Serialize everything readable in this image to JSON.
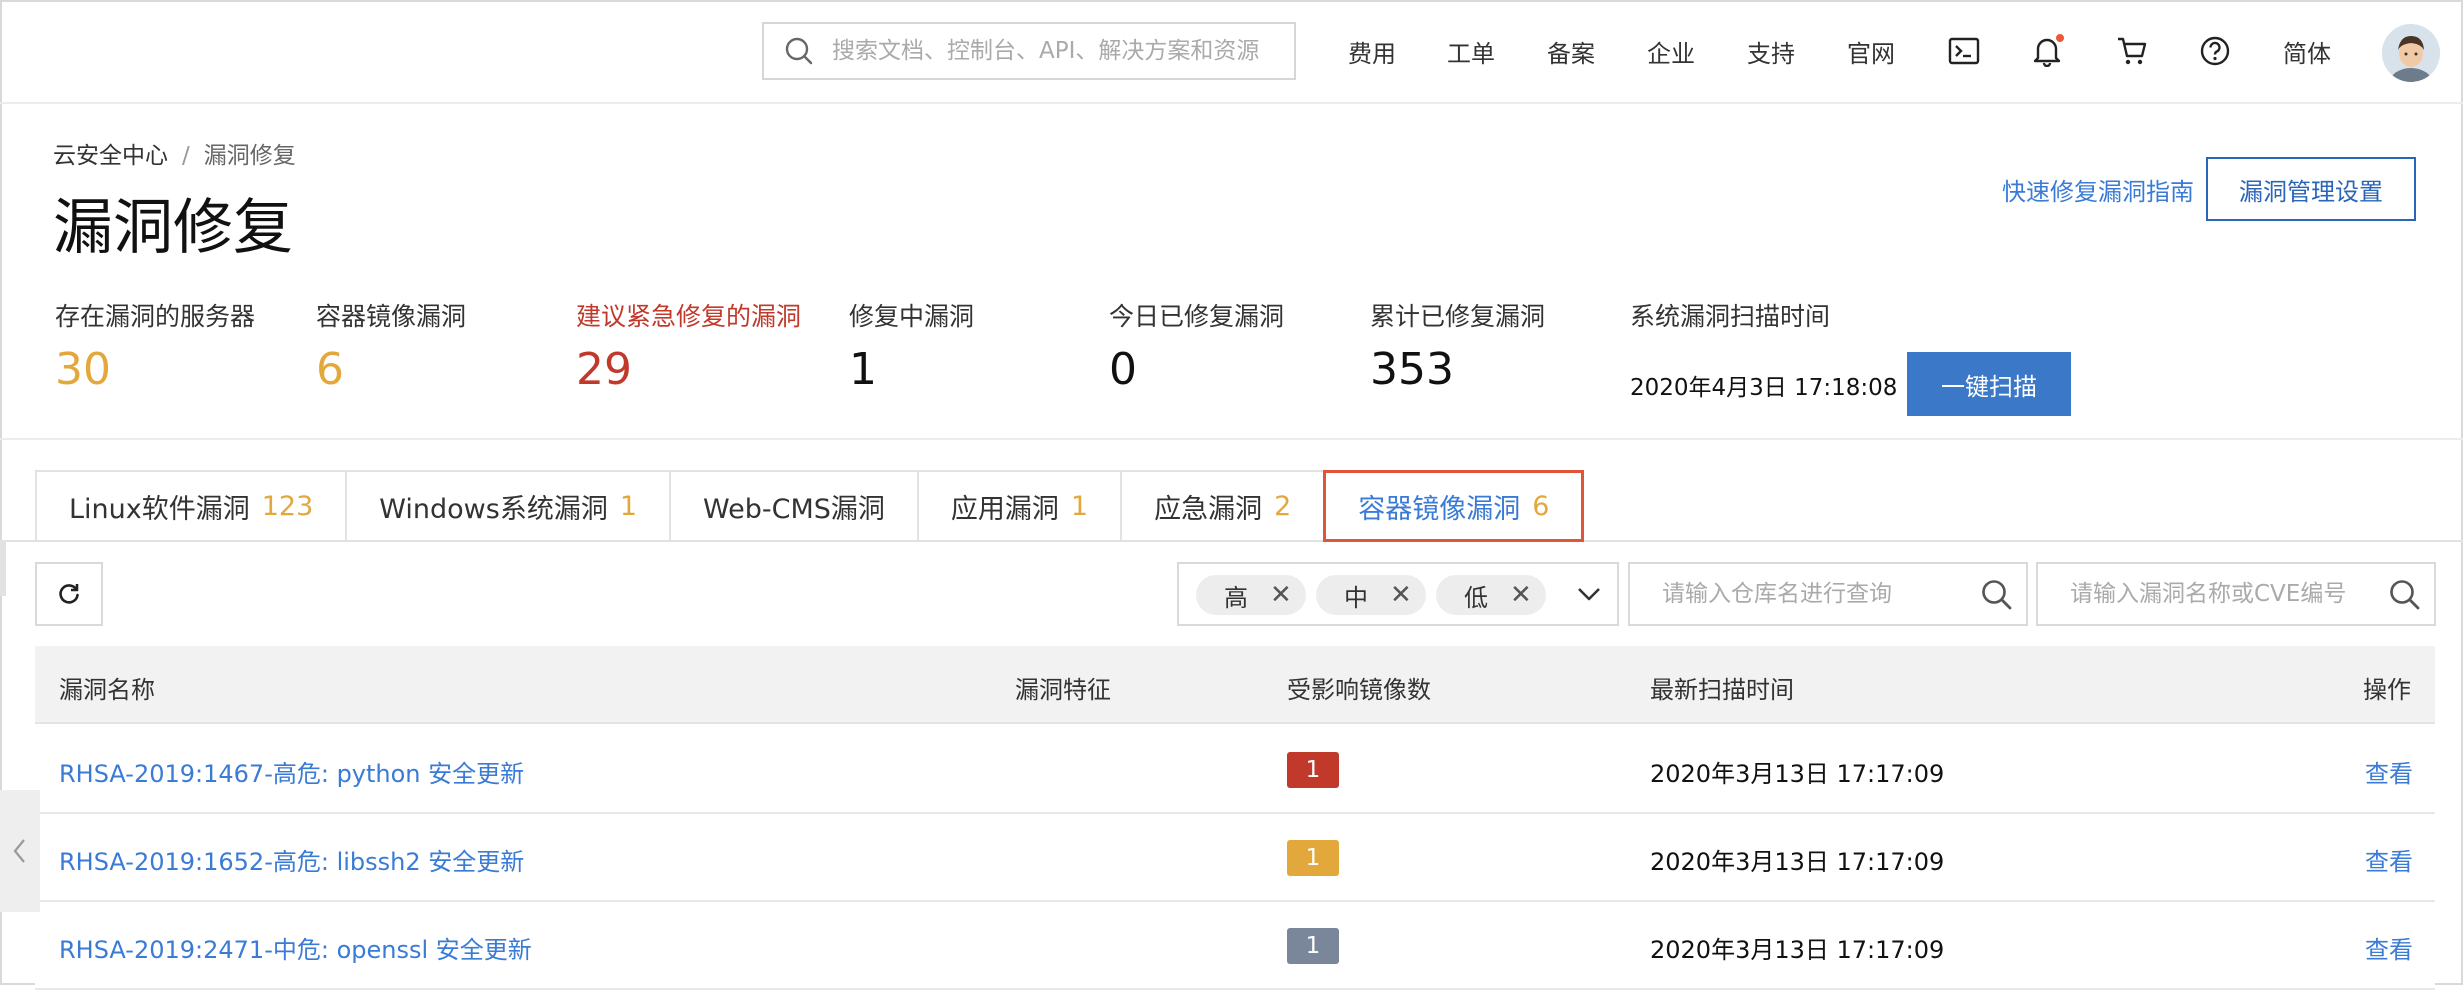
{
  "topbar": {
    "search_placeholder": "搜索文档、控制台、API、解决方案和资源",
    "nav": [
      "费用",
      "工单",
      "备案",
      "企业",
      "支持",
      "官网"
    ],
    "lang": "简体",
    "icons": [
      "terminal-icon",
      "bell-icon",
      "cart-icon",
      "help-icon"
    ]
  },
  "breadcrumb": {
    "root": "云安全中心",
    "separator": "/",
    "current": "漏洞修复"
  },
  "page_title": "漏洞修复",
  "header_actions": {
    "guide_link": "快速修复漏洞指南",
    "settings_button": "漏洞管理设置"
  },
  "stats": [
    {
      "label": "存在漏洞的服务器",
      "value": "30",
      "value_color": "#e3a83c",
      "label_color": "#333333"
    },
    {
      "label": "容器镜像漏洞",
      "value": "6",
      "value_color": "#e3a83c",
      "label_color": "#333333"
    },
    {
      "label": "建议紧急修复的漏洞",
      "value": "29",
      "value_color": "#c0392b",
      "label_color": "#c0392b"
    },
    {
      "label": "修复中漏洞",
      "value": "1",
      "value_color": "#111111",
      "label_color": "#333333"
    },
    {
      "label": "今日已修复漏洞",
      "value": "0",
      "value_color": "#111111",
      "label_color": "#333333"
    },
    {
      "label": "累计已修复漏洞",
      "value": "353",
      "value_color": "#111111",
      "label_color": "#333333"
    }
  ],
  "scan": {
    "label": "系统漏洞扫描时间",
    "time": "2020年4月3日 17:18:08",
    "button": "一键扫描"
  },
  "tabs": [
    {
      "label": "Linux软件漏洞",
      "count": "123"
    },
    {
      "label": "Windows系统漏洞",
      "count": "1"
    },
    {
      "label": "Web-CMS漏洞",
      "count": ""
    },
    {
      "label": "应用漏洞",
      "count": "1"
    },
    {
      "label": "应急漏洞",
      "count": "2"
    },
    {
      "label": "容器镜像漏洞",
      "count": "6",
      "active": true
    }
  ],
  "filters": {
    "levels": [
      "高",
      "中",
      "低"
    ],
    "repo_placeholder": "请输入仓库名进行查询",
    "vuln_placeholder": "请输入漏洞名称或CVE编号"
  },
  "table": {
    "headers": [
      "漏洞名称",
      "漏洞特征",
      "受影响镜像数",
      "最新扫描时间",
      "操作"
    ],
    "rows": [
      {
        "name": "RHSA-2019:1467-高危: python 安全更新",
        "feature": "",
        "count": "1",
        "count_color": "#c0392b",
        "time": "2020年3月13日 17:17:09",
        "action": "查看"
      },
      {
        "name": "RHSA-2019:1652-高危: libssh2 安全更新",
        "feature": "",
        "count": "1",
        "count_color": "#e3a83c",
        "time": "2020年3月13日 17:17:09",
        "action": "查看"
      },
      {
        "name": "RHSA-2019:2471-中危: openssl 安全更新",
        "feature": "",
        "count": "1",
        "count_color": "#7a869a",
        "time": "2020年3月13日 17:17:09",
        "action": "查看"
      }
    ]
  }
}
